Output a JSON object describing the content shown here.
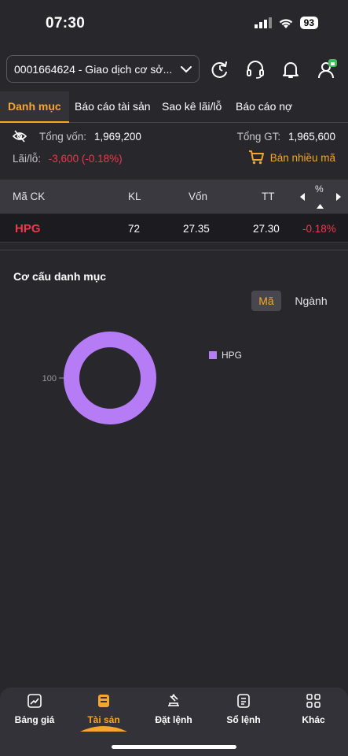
{
  "status": {
    "time": "07:30",
    "battery": "93"
  },
  "account": {
    "label": "0001664624 - Giao dịch cơ sở..."
  },
  "tabs": [
    "Danh mục",
    "Báo cáo tài sản",
    "Sao kê lãi/lỗ",
    "Báo cáo nợ"
  ],
  "summary": {
    "total_capital_label": "Tổng vốn:",
    "total_capital": "1,969,200",
    "total_value_label": "Tổng GT:",
    "total_value": "1,965,600",
    "pnl_label": "Lãi/lỗ:",
    "pnl": "-3,600 (-0.18%)",
    "sell_multi": "Bán nhiều mã"
  },
  "table": {
    "headers": [
      "Mã CK",
      "KL",
      "Vốn",
      "TT",
      "%"
    ],
    "rows": [
      {
        "symbol": "HPG",
        "qty": "72",
        "cost": "27.35",
        "price": "27.30",
        "pct": "-0.18%"
      }
    ]
  },
  "structure": {
    "title": "Cơ cấu danh mục",
    "seg_active": "Mã",
    "seg_inactive": "Ngành"
  },
  "chart_data": {
    "type": "pie",
    "categories": [
      "HPG"
    ],
    "values": [
      100
    ],
    "data_labels": [
      "100"
    ],
    "legend": [
      "HPG"
    ],
    "legend_position": "right",
    "colors": [
      "#b57cf6"
    ]
  },
  "nav": [
    {
      "label": "Bảng giá",
      "icon": "chart-icon"
    },
    {
      "label": "Tài sản",
      "icon": "wallet-icon"
    },
    {
      "label": "Đặt lệnh",
      "icon": "gavel-icon"
    },
    {
      "label": "Sổ lệnh",
      "icon": "book-icon"
    },
    {
      "label": "Khác",
      "icon": "grid-icon"
    }
  ],
  "colors": {
    "accent": "#f6a62b",
    "negative": "#f0384b",
    "background": "#28272c",
    "donut": "#b57cf6"
  }
}
